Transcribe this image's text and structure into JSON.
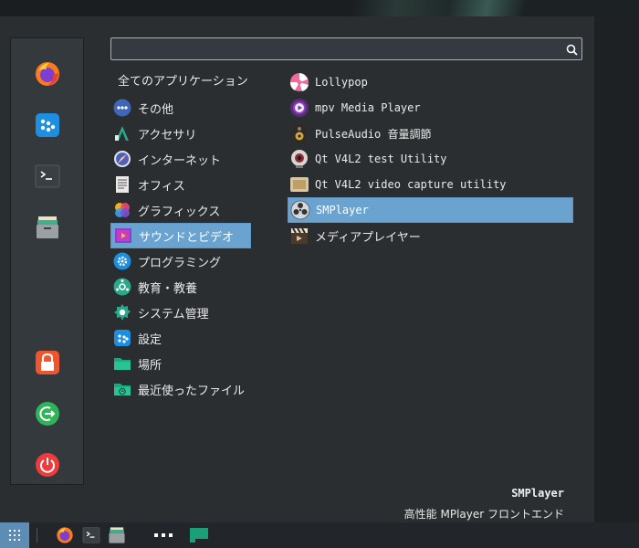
{
  "search": {
    "placeholder": "",
    "value": ""
  },
  "categories_header": "全てのアプリケーション",
  "categories": [
    {
      "label": "その他",
      "icon": "dots-icon"
    },
    {
      "label": "アクセサリ",
      "icon": "accessories-icon"
    },
    {
      "label": "インターネット",
      "icon": "internet-icon"
    },
    {
      "label": "オフィス",
      "icon": "office-icon"
    },
    {
      "label": "グラフィックス",
      "icon": "graphics-icon"
    },
    {
      "label": "サウンドとビデオ",
      "icon": "multimedia-icon",
      "selected": true
    },
    {
      "label": "プログラミング",
      "icon": "development-icon"
    },
    {
      "label": "教育・教養",
      "icon": "education-icon"
    },
    {
      "label": "システム管理",
      "icon": "system-icon"
    },
    {
      "label": "設定",
      "icon": "settings-icon"
    },
    {
      "label": "場所",
      "icon": "folder-icon"
    },
    {
      "label": "最近使ったファイル",
      "icon": "recent-folder-icon"
    }
  ],
  "apps": [
    {
      "label": "Lollypop",
      "icon": "lollypop-icon"
    },
    {
      "label": "mpv Media Player",
      "icon": "mpv-icon"
    },
    {
      "label": "PulseAudio 音量調節",
      "icon": "speaker-icon"
    },
    {
      "label": "Qt V4L2 test Utility",
      "icon": "webcam-icon"
    },
    {
      "label": "Qt V4L2 video capture utility",
      "icon": "video-capture-icon"
    },
    {
      "label": "SMPlayer",
      "icon": "smplayer-icon",
      "selected": true
    },
    {
      "label": "メディアプレイヤー",
      "icon": "clapperboard-icon"
    }
  ],
  "description": {
    "title": "SMPlayer",
    "text": "高性能 MPlayer フロントエンド"
  },
  "favorites": [
    "firefox-icon",
    "app-grid-icon",
    "terminal-icon",
    "file-manager-icon"
  ],
  "session": [
    "lock-icon",
    "logout-icon",
    "power-icon"
  ],
  "colors": {
    "selection": "#6aa3d0",
    "search_border": "#8fb6d3",
    "panel": "#2a2e31"
  }
}
